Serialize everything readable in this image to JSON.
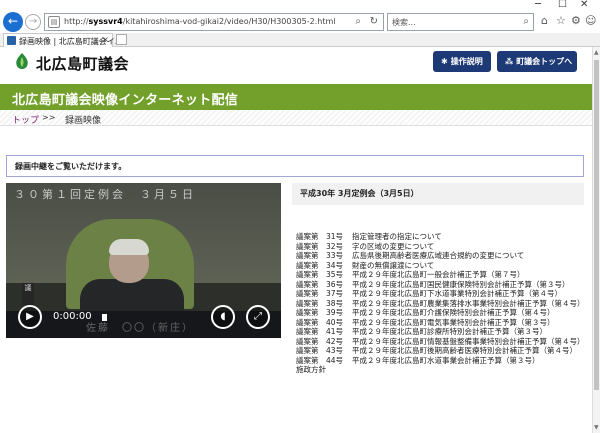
{
  "browser": {
    "url_prefix": "http://",
    "url_host": "syssvr4",
    "url_path": "/kitahiroshima-vod-gikai2/video/H30/H300305-2.html",
    "search_placeholder": "検索...",
    "tab_label": "録画映像 | 北広島町議会イ...",
    "tab_close": "×",
    "icons": [
      "home-icon",
      "star-icon",
      "gear-icon",
      "smiley-icon"
    ]
  },
  "header": {
    "site_title": "北広島町議会",
    "btn_help": "操作説明",
    "btn_top": "町議会トップへ",
    "accent": "#1e3a76"
  },
  "banner": {
    "title": "北広島町議会映像インターネット配信",
    "color": "#72a02a"
  },
  "breadcrumb": {
    "home": "トップ",
    "sep": ">>",
    "current": "録画映像"
  },
  "notice": {
    "text": "録画中継をご覧いただけます。"
  },
  "video": {
    "caption": "３０第１回定例会　３月５日",
    "subtitle": "佐藤　〇〇（新庄）",
    "nameplate": "議",
    "time": "0:00:00",
    "progress_fraction": 0.0
  },
  "session": {
    "title": "平成30年 3月定例会（3月5日）"
  },
  "agenda": [
    {
      "no": "議案第　31号",
      "title": "指定管理者の指定について"
    },
    {
      "no": "議案第　32号",
      "title": "字の区域の変更について"
    },
    {
      "no": "議案第　33号",
      "title": "広島県後期高齢者医療広域連合規約の変更について"
    },
    {
      "no": "議案第　34号",
      "title": "財産の無償譲渡について"
    },
    {
      "no": "議案第　35号",
      "title": "平成２９年度北広島町一般会計補正予算（第７号）"
    },
    {
      "no": "議案第　36号",
      "title": "平成２９年度北広島町国民健康保険特別会計補正予算（第３号）"
    },
    {
      "no": "議案第　37号",
      "title": "平成２９年度北広島町下水道事業特別会計補正予算（第４号）"
    },
    {
      "no": "議案第　38号",
      "title": "平成２９年度北広島町農業集落排水事業特別会計補正予算（第４号）"
    },
    {
      "no": "議案第　39号",
      "title": "平成２９年度北広島町介護保険特別会計補正予算（第４号）"
    },
    {
      "no": "議案第　40号",
      "title": "平成２９年度北広島町電気事業特別会計補正予算（第３号）"
    },
    {
      "no": "議案第　41号",
      "title": "平成２９年度北広島町診療所特別会計補正予算（第３号）"
    },
    {
      "no": "議案第　42号",
      "title": "平成２９年度北広島町情報基盤整備事業特別会計補正予算（第４号）"
    },
    {
      "no": "議案第　43号",
      "title": "平成２９年度北広島町後期高齢者医療特別会計補正予算（第４号）"
    },
    {
      "no": "議案第　44号",
      "title": "平成２９年度北広島町水道事業会計補正予算（第３号）"
    }
  ],
  "agenda_tail": "施政方針"
}
